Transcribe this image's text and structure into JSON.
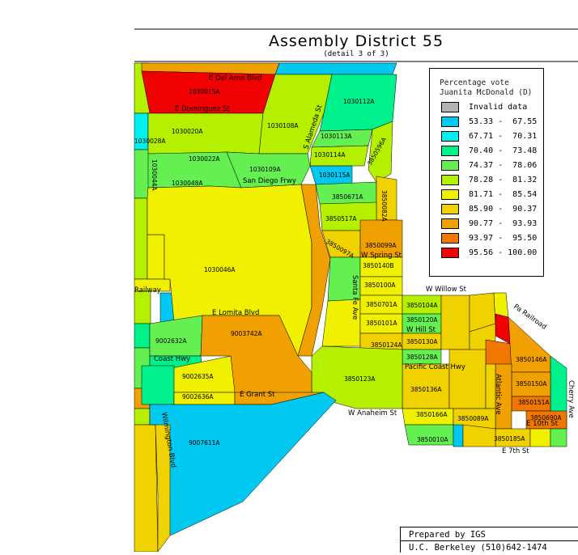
{
  "title": "Assembly District 55",
  "subtitle": "(detail 3 of 3)",
  "legend": {
    "title_line1": "Percentage vote",
    "title_line2": "Juanita McDonald (D)",
    "items": [
      {
        "label": "Invalid data",
        "color": "#b4b4b4"
      },
      {
        "label": "53.33 -  67.55",
        "color": "#00c8f0"
      },
      {
        "label": "67.71 -  70.31",
        "color": "#00f0f0"
      },
      {
        "label": "70.40 -  73.48",
        "color": "#00f08c"
      },
      {
        "label": "74.37 -  78.06",
        "color": "#64f050"
      },
      {
        "label": "78.28 -  81.32",
        "color": "#b4f000"
      },
      {
        "label": "81.71 -  85.54",
        "color": "#f0f000"
      },
      {
        "label": "85.90 -  90.37",
        "color": "#f0d200"
      },
      {
        "label": "90.77 -  93.93",
        "color": "#f0a000"
      },
      {
        "label": "93.97 -  95.50",
        "color": "#f07800"
      },
      {
        "label": "95.56 - 100.00",
        "color": "#f00000"
      }
    ]
  },
  "credit": {
    "line1": "Prepared by IGS",
    "line2": "U.C. Berkeley (510)642-1474"
  },
  "streets": [
    "E Del Amo Blvd",
    "E Dominguez St",
    "S Alameda St",
    "San Diego Frwy",
    "W Spring St",
    "Santa Fe Ave",
    "Railway",
    "E Lomita Blvd",
    "Coast Hwy",
    "Pacific Coast Hwy",
    "E Grant St",
    "W Anaheim St",
    "W Willow St",
    "W Hill St",
    "Pa Railroad",
    "Atlantic Ave",
    "Cherry Ave",
    "E 10th St",
    "E 7th St",
    "Wilmington Blvd"
  ],
  "precincts": [
    "1030015A",
    "1030112A",
    "1030108A",
    "1030020A",
    "1030113A",
    "1030114A",
    "1030022A",
    "1030109A",
    "1030048A",
    "1030115A",
    "3850671A",
    "3850517A",
    "3850097A",
    "3850099A",
    "3850140B",
    "3850100A",
    "1030046A",
    "3850701A",
    "3850101A",
    "3850104A",
    "3850120A",
    "3850124A",
    "3850130A",
    "3850128A",
    "3850123A",
    "3850136A",
    "3850146A",
    "3850150A",
    "3850151A",
    "3850690A",
    "3850185A",
    "3850010A",
    "3850166A",
    "3850089A",
    "9003742A",
    "9002632A",
    "9002635A",
    "9002636A",
    "9007611A",
    "1030028A",
    "1030044A",
    "3850082A",
    "3850596A"
  ]
}
